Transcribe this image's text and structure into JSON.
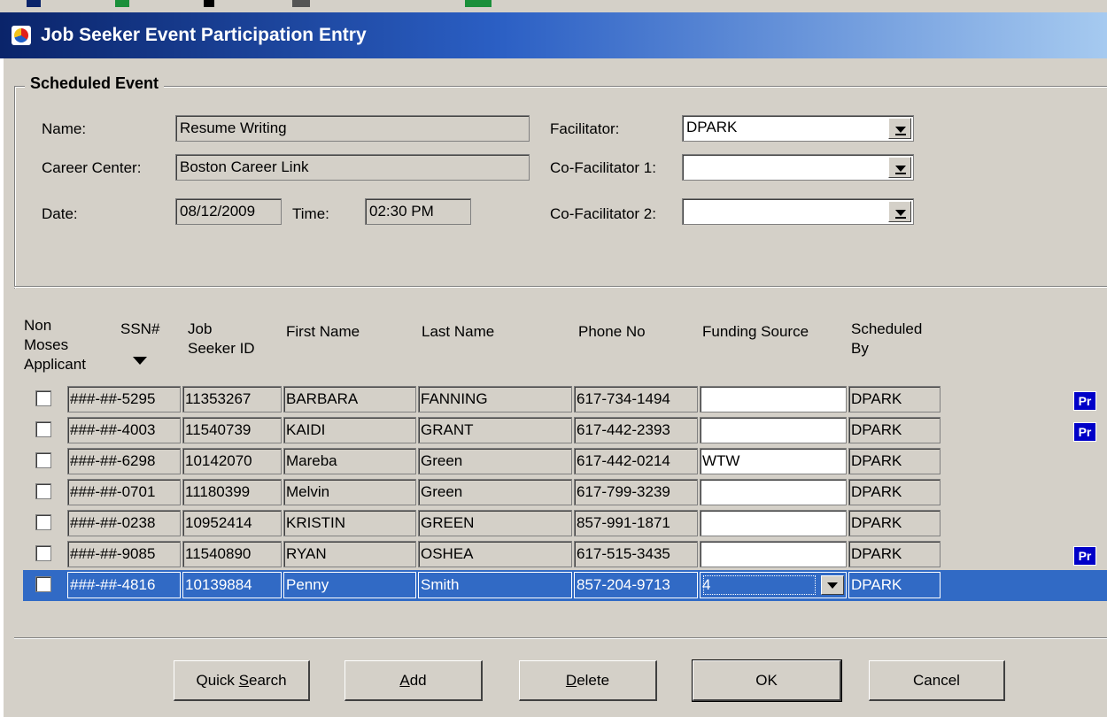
{
  "window": {
    "title": "Job Seeker Event Participation Entry"
  },
  "scheduled_event": {
    "legend": "Scheduled Event",
    "name_label": "Name:",
    "name_value": "Resume Writing",
    "center_label": "Career Center:",
    "center_value": "Boston Career Link",
    "date_label": "Date:",
    "date_value": "08/12/2009",
    "time_label": "Time:",
    "time_value": "02:30 PM",
    "facilitator_label": "Facilitator:",
    "facilitator_value": "DPARK",
    "cofac1_label": "Co-Facilitator 1:",
    "cofac1_value": "",
    "cofac2_label": "Co-Facilitator 2:",
    "cofac2_value": ""
  },
  "grid": {
    "headers": {
      "non_moses": [
        "Non",
        "Moses",
        "Applicant"
      ],
      "ssn": "SSN#",
      "job_seeker_id": [
        "Job",
        "Seeker ID"
      ],
      "first_name": "First Name",
      "last_name": "Last Name",
      "phone": "Phone No",
      "funding": "Funding Source",
      "scheduled_by": [
        "Scheduled",
        "By"
      ]
    },
    "rows": [
      {
        "ssn": "###-##-5295",
        "id": "11353267",
        "first": "BARBARA",
        "last": "FANNING",
        "phone": "617-734-1494",
        "funding": "",
        "by": "DPARK",
        "pr": "Pr"
      },
      {
        "ssn": "###-##-4003",
        "id": "11540739",
        "first": "KAIDI",
        "last": "GRANT",
        "phone": "617-442-2393",
        "funding": "",
        "by": "DPARK",
        "pr": "Pr"
      },
      {
        "ssn": "###-##-6298",
        "id": "10142070",
        "first": "Mareba",
        "last": "Green",
        "phone": "617-442-0214",
        "funding": "WTW",
        "by": "DPARK",
        "pr": ""
      },
      {
        "ssn": "###-##-0701",
        "id": "11180399",
        "first": "Melvin",
        "last": "Green",
        "phone": "617-799-3239",
        "funding": "",
        "by": "DPARK",
        "pr": ""
      },
      {
        "ssn": "###-##-0238",
        "id": "10952414",
        "first": "KRISTIN",
        "last": "GREEN",
        "phone": "857-991-1871",
        "funding": "",
        "by": "DPARK",
        "pr": ""
      },
      {
        "ssn": "###-##-9085",
        "id": "11540890",
        "first": "RYAN",
        "last": "OSHEA",
        "phone": "617-515-3435",
        "funding": "",
        "by": "DPARK",
        "pr": "Pr"
      },
      {
        "ssn": "###-##-4816",
        "id": "10139884",
        "first": "Penny",
        "last": "Smith",
        "phone": "857-204-9713",
        "funding": "4",
        "by": "DPARK",
        "pr": ""
      }
    ]
  },
  "buttons": {
    "quick_search": {
      "pre": "Quick ",
      "key": "S",
      "post": "earch"
    },
    "add": {
      "pre": "",
      "key": "A",
      "post": "dd"
    },
    "delete": {
      "pre": "",
      "key": "D",
      "post": "elete"
    },
    "ok": "OK",
    "cancel": "Cancel"
  },
  "colors": {
    "selection": "#316ac5",
    "title_start": "#0a246a",
    "title_end": "#a6caf0",
    "face": "#d4d0c8"
  }
}
